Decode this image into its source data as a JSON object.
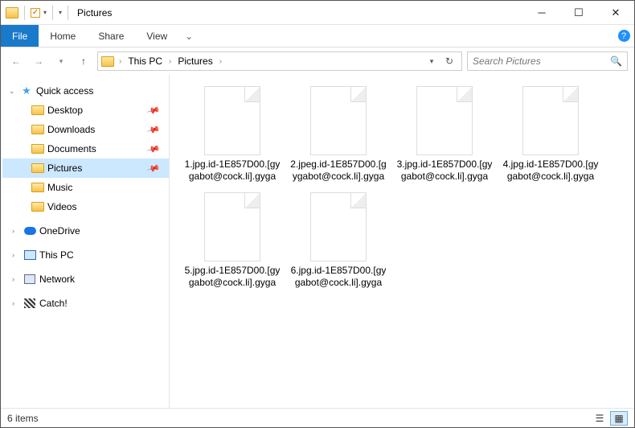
{
  "window": {
    "title": "Pictures"
  },
  "ribbon": {
    "file": "File",
    "tabs": [
      "Home",
      "Share",
      "View"
    ]
  },
  "breadcrumb": {
    "items": [
      "This PC",
      "Pictures"
    ]
  },
  "search": {
    "placeholder": "Search Pictures"
  },
  "sidebar": {
    "quick_access": "Quick access",
    "qa_items": [
      {
        "label": "Desktop",
        "pinned": true
      },
      {
        "label": "Downloads",
        "pinned": true
      },
      {
        "label": "Documents",
        "pinned": true
      },
      {
        "label": "Pictures",
        "pinned": true,
        "selected": true
      },
      {
        "label": "Music",
        "pinned": false
      },
      {
        "label": "Videos",
        "pinned": false
      }
    ],
    "roots": [
      {
        "label": "OneDrive",
        "icon": "onedrive"
      },
      {
        "label": "This PC",
        "icon": "thispc"
      },
      {
        "label": "Network",
        "icon": "network"
      },
      {
        "label": "Catch!",
        "icon": "catch"
      }
    ]
  },
  "files": [
    {
      "name": "1.jpg.id-1E857D00.[gygabot@cock.li].gyga"
    },
    {
      "name": "2.jpeg.id-1E857D00.[gygabot@cock.li].gyga"
    },
    {
      "name": "3.jpg.id-1E857D00.[gygabot@cock.li].gyga"
    },
    {
      "name": "4.jpg.id-1E857D00.[gygabot@cock.li].gyga"
    },
    {
      "name": "5.jpg.id-1E857D00.[gygabot@cock.li].gyga"
    },
    {
      "name": "6.jpg.id-1E857D00.[gygabot@cock.li].gyga"
    }
  ],
  "status": {
    "count_text": "6 items"
  }
}
